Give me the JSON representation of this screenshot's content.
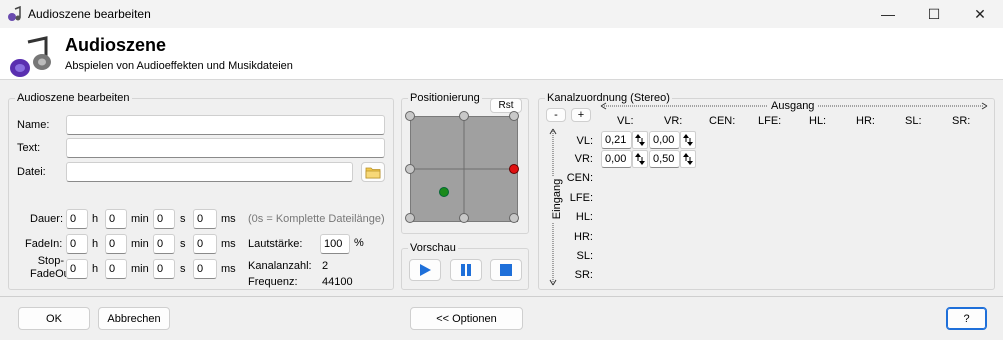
{
  "window": {
    "title": "Audioszene bearbeiten",
    "minimize": "—",
    "maximize": "☐",
    "close": "✕"
  },
  "header": {
    "title": "Audioszene",
    "subtitle": "Abspielen von Audioeffekten und Musikdateien"
  },
  "edit_group": {
    "legend": "Audioszene bearbeiten",
    "name_label": "Name:",
    "name_value": "",
    "text_label": "Text:",
    "text_value": "",
    "file_label": "Datei:",
    "file_value": "",
    "folder_icon": "folder-icon",
    "rows": [
      {
        "label": "Dauer:",
        "h": "0",
        "min": "0",
        "s": "0",
        "ms": "0"
      },
      {
        "label": "FadeIn:",
        "h": "0",
        "min": "0",
        "s": "0",
        "ms": "0"
      },
      {
        "label": "Stop-FadeOut:",
        "h": "0",
        "min": "0",
        "s": "0",
        "ms": "0"
      }
    ],
    "unit_h": "h",
    "unit_min": "min",
    "unit_s": "s",
    "unit_ms": "ms",
    "duration_hint": "(0s = Komplette Dateilänge)",
    "volume_label": "Lautstärke:",
    "volume_value": "100",
    "volume_unit": "%",
    "channels_label": "Kanalanzahl:",
    "channels_value": "2",
    "freq_label": "Frequenz:",
    "freq_value": "44100"
  },
  "positioning": {
    "legend": "Positionierung",
    "reset_label": "Rst"
  },
  "preview": {
    "legend": "Vorschau",
    "play_icon": "play-icon",
    "pause_icon": "pause-icon",
    "stop_icon": "stop-icon"
  },
  "channels": {
    "legend": "Kanalzuordnung (Stereo)",
    "minus_label": "-",
    "plus_label": "+",
    "output_label": "Ausgang",
    "input_label": "Eingang",
    "columns": [
      "VL:",
      "VR:",
      "CEN:",
      "LFE:",
      "HL:",
      "HR:",
      "SL:",
      "SR:"
    ],
    "rows": [
      "VL:",
      "VR:",
      "CEN:",
      "LFE:",
      "HL:",
      "HR:",
      "SL:",
      "SR:"
    ],
    "matrix": [
      [
        "0,21",
        "0,00"
      ],
      [
        "0,00",
        "0,50"
      ]
    ]
  },
  "footer": {
    "ok_label": "OK",
    "cancel_label": "Abbrechen",
    "options_label": "<< Optionen",
    "help_label": "?"
  },
  "colors": {
    "accent": "#1e6fd9",
    "point_green": "#1a8a1a",
    "point_red": "#e01010"
  }
}
